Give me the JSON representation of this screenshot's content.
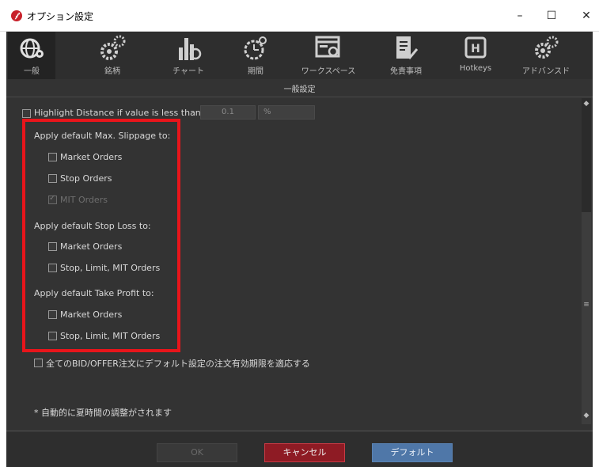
{
  "window": {
    "title": "オプション設定",
    "app_icon": "app-logo-icon",
    "min": "–",
    "max": "☐",
    "close": "✕"
  },
  "toolbar": {
    "items": [
      {
        "label": "一般",
        "icon": "globe-gear-icon",
        "active": true
      },
      {
        "label": "銘柄",
        "icon": "gears-icon",
        "active": false
      },
      {
        "label": "チャート",
        "icon": "chart-gear-icon",
        "active": false
      },
      {
        "label": "期間",
        "icon": "clock-gear-icon",
        "active": false
      },
      {
        "label": "ワークスペース",
        "icon": "workspace-gear-icon",
        "active": false
      },
      {
        "label": "免責事項",
        "icon": "document-pen-icon",
        "active": false
      },
      {
        "label": "Hotkeys",
        "icon": "hotkeys-icon",
        "active": false
      },
      {
        "label": "アドバンスド",
        "icon": "advanced-gears-icon",
        "active": false
      }
    ],
    "hotkeys_glyph": "H"
  },
  "section": {
    "title": "一般設定",
    "highlight_distance": {
      "label": "Highlight Distance if value is less than",
      "value": "0.1",
      "unit": "%",
      "checked": false
    },
    "slippage": {
      "heading": "Apply default Max. Slippage to:",
      "market": {
        "label": "Market Orders",
        "checked": false
      },
      "stop": {
        "label": "Stop Orders",
        "checked": false
      },
      "mit": {
        "label": "MIT Orders",
        "checked": true,
        "disabled": true
      }
    },
    "stop_loss": {
      "heading": "Apply default Stop Loss to:",
      "market": {
        "label": "Market Orders",
        "checked": false
      },
      "stop_limit_mit": {
        "label": "Stop, Limit, MIT Orders",
        "checked": false
      }
    },
    "take_profit": {
      "heading": "Apply default Take Profit to:",
      "market": {
        "label": "Market Orders",
        "checked": false
      },
      "stop_limit_mit": {
        "label": "Stop, Limit, MIT Orders",
        "checked": false
      }
    },
    "bid_offer": {
      "label": "全てのBID/OFFER注文にデフォルト設定の注文有効期限を適応する",
      "checked": false
    },
    "note": "* 自動的に夏時間の調整がされます"
  },
  "scrollbar": {
    "up": "◆",
    "mid": "≡",
    "down": "◆"
  },
  "footer": {
    "ok": "OK",
    "cancel": "キャンセル",
    "default": "デフォルト"
  },
  "colors": {
    "highlight": "#e8151b",
    "cancel": "#8e1b24",
    "default": "#4f77a8",
    "panel": "#333333"
  }
}
